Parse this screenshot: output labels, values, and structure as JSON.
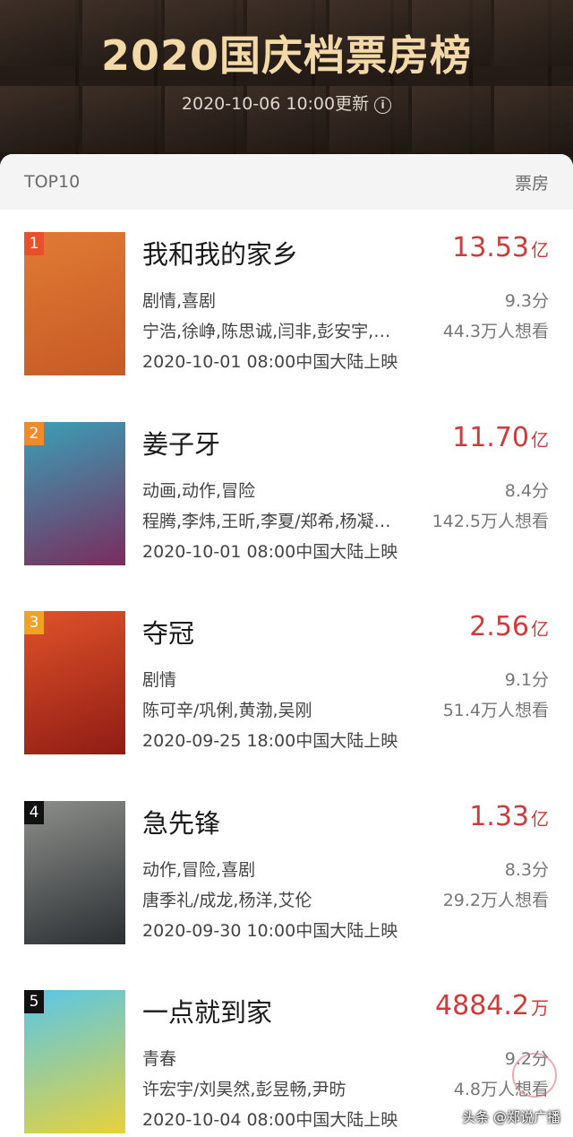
{
  "header": {
    "title": "2020国庆档票房榜",
    "updated": "2020-10-06 10:00更新",
    "info_icon": "info-icon"
  },
  "list": {
    "left_label": "TOP10",
    "right_label": "票房",
    "items": [
      {
        "rank": "1",
        "rank_color": "#e8502c",
        "name": "我和我的家乡",
        "box_value": "13.53",
        "box_unit": "亿",
        "genre": "剧情,喜剧",
        "score": "9.3分",
        "cast": "宁浩,徐峥,陈思诚,闫非,彭安宇,…",
        "want": "44.3万人想看",
        "release": "2020-10-01 08:00中国大陆上映",
        "poster_colors": [
          "#e07a34",
          "#c75a25"
        ]
      },
      {
        "rank": "2",
        "rank_color": "#f08b2a",
        "name": "姜子牙",
        "box_value": "11.70",
        "box_unit": "亿",
        "genre": "动画,动作,冒险",
        "score": "8.4分",
        "cast": "程腾,李炜,王昕,李夏/郑希,杨凝…",
        "want": "142.5万人想看",
        "release": "2020-10-01 08:00中国大陆上映",
        "poster_colors": [
          "#3aa0b8",
          "#7a2c5c"
        ]
      },
      {
        "rank": "3",
        "rank_color": "#f2a123",
        "name": "夺冠",
        "box_value": "2.56",
        "box_unit": "亿",
        "genre": "剧情",
        "score": "9.1分",
        "cast": "陈可辛/巩俐,黄渤,吴刚",
        "want": "51.4万人想看",
        "release": "2020-09-25 18:00中国大陆上映",
        "poster_colors": [
          "#e0522a",
          "#8f1c14"
        ]
      },
      {
        "rank": "4",
        "rank_color": "#111111",
        "name": "急先锋",
        "box_value": "1.33",
        "box_unit": "亿",
        "genre": "动作,冒险,喜剧",
        "score": "8.3分",
        "cast": "唐季礼/成龙,杨洋,艾伦",
        "want": "29.2万人想看",
        "release": "2020-09-30 10:00中国大陆上映",
        "poster_colors": [
          "#8c8f8a",
          "#2c2f33"
        ]
      },
      {
        "rank": "5",
        "rank_color": "#111111",
        "name": "一点就到家",
        "box_value": "4884.2",
        "box_unit": "万",
        "genre": "青春",
        "score": "9.2分",
        "cast": "许宏宇/刘昊然,彭昱畅,尹昉",
        "want": "4.8万人想看",
        "release": "2020-10-04 08:00中国大陆上映",
        "poster_colors": [
          "#58c6e8",
          "#e8d23a"
        ]
      }
    ]
  },
  "watermark": "头条 @郑说广播"
}
